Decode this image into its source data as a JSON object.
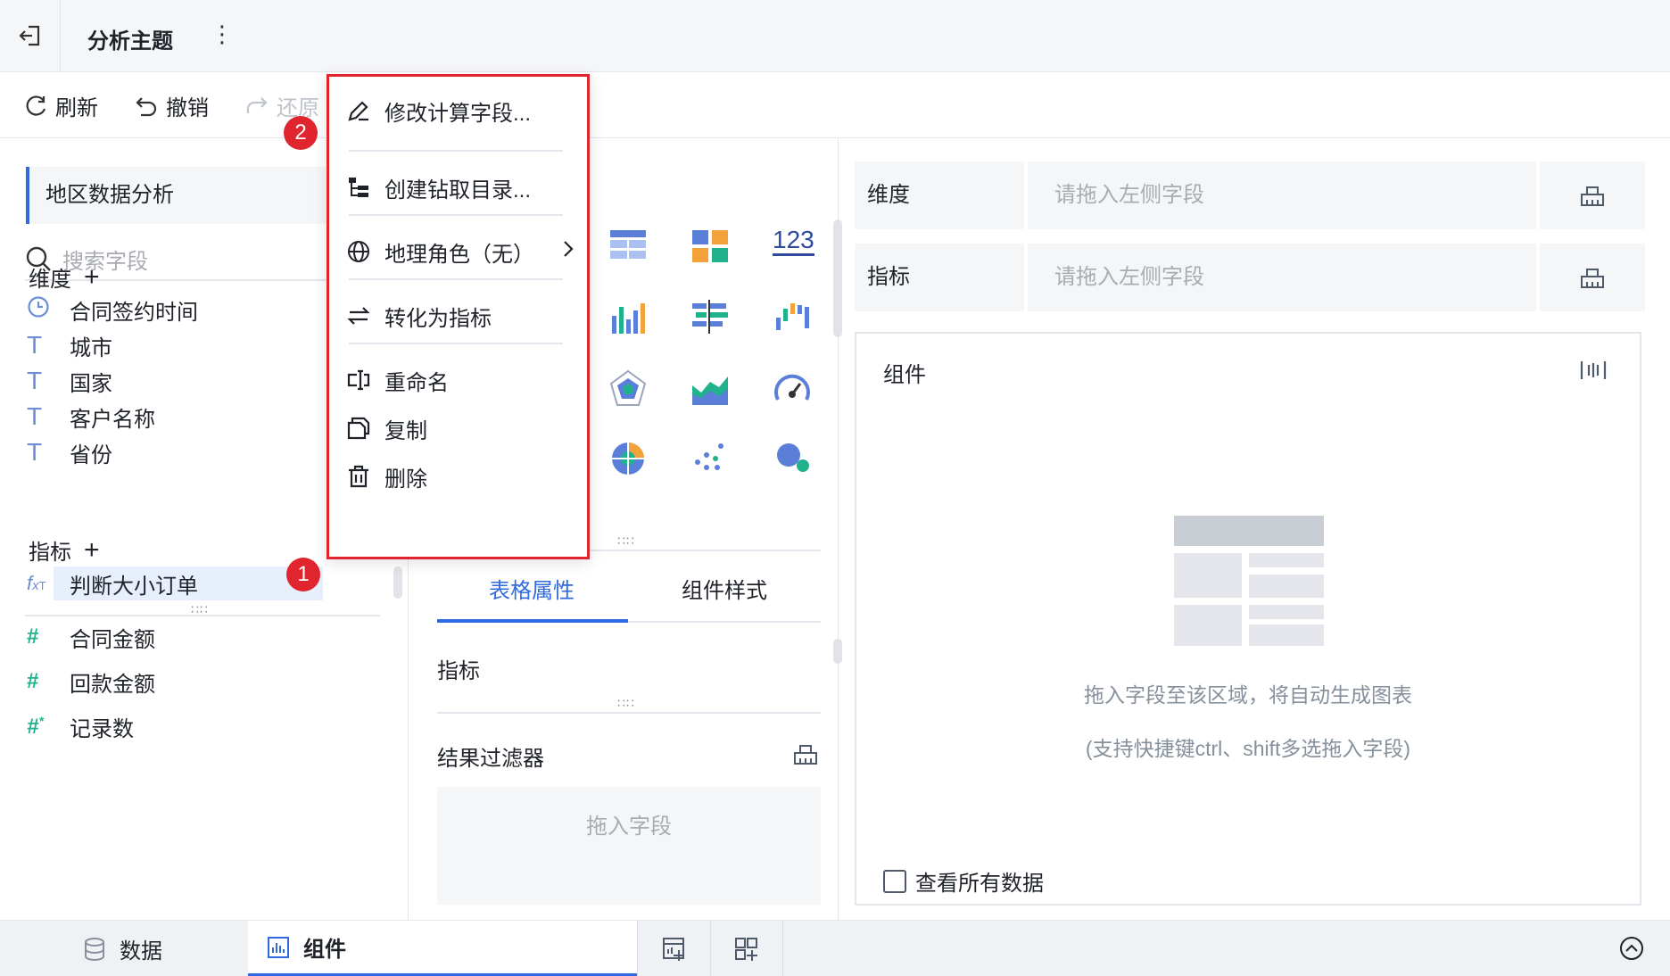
{
  "topbar": {
    "title": "分析主题"
  },
  "toolbar": {
    "refresh": "刷新",
    "undo": "撤销",
    "redo": "还原"
  },
  "left": {
    "dataset_name": "地区数据分析",
    "search_placeholder": "搜索字段",
    "dimensions_title": "维度",
    "dimensions": [
      {
        "label": "合同签约时间",
        "icon": "clock-icon"
      },
      {
        "label": "城市",
        "icon": "text-icon"
      },
      {
        "label": "国家",
        "icon": "text-icon"
      },
      {
        "label": "客户名称",
        "icon": "text-icon"
      },
      {
        "label": "省份",
        "icon": "text-icon"
      },
      {
        "label": "判断大小订单",
        "icon": "formula-text-icon"
      }
    ],
    "measures_title": "指标",
    "measures": [
      {
        "label": "合同金额",
        "icon": "number-icon"
      },
      {
        "label": "回款金额",
        "icon": "number-icon"
      },
      {
        "label": "记录数",
        "icon": "record-count-icon"
      }
    ]
  },
  "badges": {
    "one": "1",
    "two": "2"
  },
  "context_menu": {
    "items": [
      {
        "label": "修改计算字段...",
        "icon": "edit-icon"
      },
      {
        "label": "创建钻取目录...",
        "icon": "drill-tree-icon"
      },
      {
        "label": "地理角色（无）",
        "icon": "globe-icon",
        "submenu": true
      },
      {
        "label": "转化为指标",
        "icon": "swap-icon"
      },
      {
        "label": "重命名",
        "icon": "rename-icon"
      },
      {
        "label": "复制",
        "icon": "copy-icon"
      },
      {
        "label": "删除",
        "icon": "trash-icon"
      }
    ]
  },
  "middle": {
    "chart_types_visible_label": "123",
    "tabs": [
      "表格属性",
      "组件样式"
    ],
    "measure_label": "指标",
    "filter_label": "结果过滤器",
    "filter_drop": "拖入字段"
  },
  "right": {
    "dimension_label": "维度",
    "dimension_placeholder": "请拖入左侧字段",
    "measure_label": "指标",
    "measure_placeholder": "请拖入左侧字段",
    "component_title": "组件",
    "empty_hint": "拖入字段至该区域，将自动生成图表",
    "empty_hint_sub": "(支持快捷键ctrl、shift多选拖入字段)",
    "view_all": "查看所有数据"
  },
  "bottom": {
    "data_tab": "数据",
    "component_tab": "组件"
  },
  "colors": {
    "accent": "#2f6bdf",
    "highlight_red": "#e0252f",
    "green": "#20b28c"
  }
}
